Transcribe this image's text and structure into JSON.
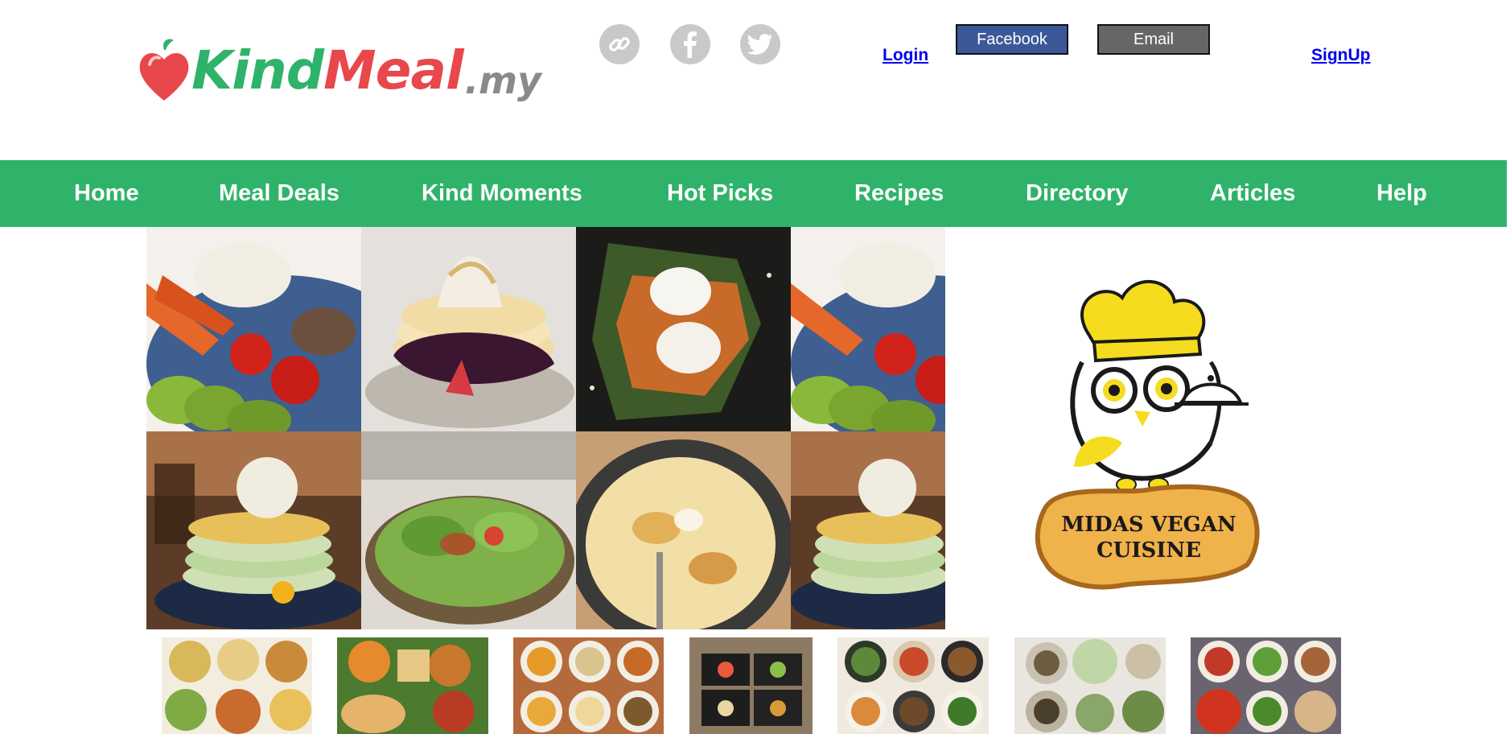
{
  "header": {
    "logo": {
      "word1": "Kind",
      "word2": "Meal",
      "tld": ".my"
    },
    "social": [
      {
        "icon": "link-icon"
      },
      {
        "icon": "facebook-icon"
      },
      {
        "icon": "twitter-icon"
      }
    ],
    "auth": {
      "login_label": "Login",
      "facebook_label": "Facebook",
      "email_label": "Email",
      "signup_label": "SignUp"
    }
  },
  "nav": {
    "items": [
      {
        "label": "Home"
      },
      {
        "label": "Meal Deals"
      },
      {
        "label": "Kind Moments"
      },
      {
        "label": "Hot Picks"
      },
      {
        "label": "Recipes"
      },
      {
        "label": "Directory"
      },
      {
        "label": "Articles"
      },
      {
        "label": "Help"
      }
    ]
  },
  "featured": {
    "restaurant_logo_text_line1": "MIDAS VEGAN",
    "restaurant_logo_text_line2": "CUISINE"
  },
  "colors": {
    "brand_green": "#2fb36a",
    "brand_red": "#e8474b",
    "facebook_blue": "#3b5998",
    "email_gray": "#666666",
    "link_blue": "#0000ee"
  }
}
